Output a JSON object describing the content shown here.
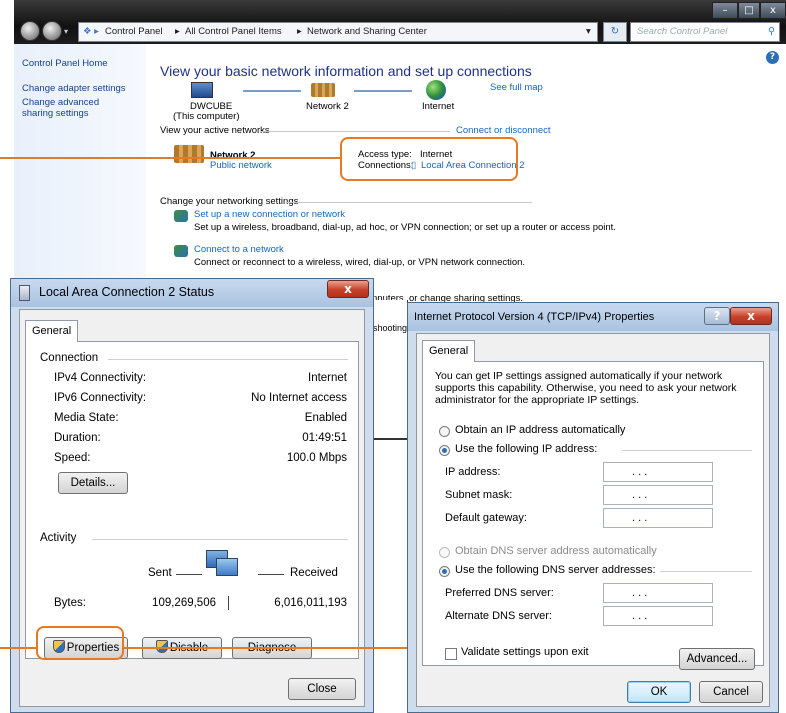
{
  "control_panel": {
    "breadcrumbs": [
      "Control Panel",
      "All Control Panel Items",
      "Network and Sharing Center"
    ],
    "search_placeholder": "Search Control Panel",
    "sidebar": [
      "Control Panel Home",
      "Change adapter settings",
      "Change advanced sharing settings"
    ],
    "title": "View your basic network information and set up connections",
    "see_full_map": "See full map",
    "map": {
      "computer": "DWCUBE",
      "computer_sub": "(This computer)",
      "network": "Network  2",
      "internet": "Internet"
    },
    "active_networks_label": "View your active networks",
    "connect_or_disconnect": "Connect or disconnect",
    "active_network_name": "Network  2",
    "active_network_type": "Public network",
    "access_type_label": "Access type:",
    "access_type_value": "Internet",
    "connections_label": "Connections:",
    "connections_value": "Local Area Connection 2",
    "change_settings_label": "Change your networking settings",
    "tasks": [
      {
        "title": "Set up a new connection or network",
        "desc": "Set up a wireless, broadband, dial-up, ad hoc, or VPN connection; or set up a router or access point."
      },
      {
        "title": "Connect to a network",
        "desc": "Connect or reconnect to a wireless, wired, dial-up, or VPN network connection."
      }
    ],
    "partial_text_1": "nputers, or change sharing settings.",
    "partial_text_2": "shooting"
  },
  "status_dialog": {
    "title": "Local Area Connection 2 Status",
    "close_x": "x",
    "tab": "General",
    "connection_label": "Connection",
    "rows": [
      {
        "label": "IPv4 Connectivity:",
        "value": "Internet"
      },
      {
        "label": "IPv6 Connectivity:",
        "value": "No Internet access"
      },
      {
        "label": "Media State:",
        "value": "Enabled"
      },
      {
        "label": "Duration:",
        "value": "01:49:51"
      },
      {
        "label": "Speed:",
        "value": "100.0 Mbps"
      }
    ],
    "details_button": "Details...",
    "activity_label": "Activity",
    "sent": "Sent",
    "received": "Received",
    "bytes_label": "Bytes:",
    "bytes_sent": "109,269,506",
    "bytes_received": "6,016,011,193",
    "properties_button": "Properties",
    "disable_button": "Disable",
    "diagnose_button": "Diagnose",
    "close_button": "Close"
  },
  "ip_dialog": {
    "title": "Internet Protocol Version 4 (TCP/IPv4) Properties",
    "help_btn": "?",
    "close_x": "x",
    "tab": "General",
    "description": "You can get IP settings assigned automatically if your network supports this capability. Otherwise, you need to ask your network administrator for the appropriate IP settings.",
    "obtain_ip_auto": "Obtain an IP address automatically",
    "use_following_ip": "Use the following IP address:",
    "ip_address": "IP address:",
    "subnet_mask": "Subnet mask:",
    "default_gateway": "Default gateway:",
    "obtain_dns_auto": "Obtain DNS server address automatically",
    "use_following_dns": "Use the following DNS server addresses:",
    "preferred_dns": "Preferred DNS server:",
    "alternate_dns": "Alternate DNS server:",
    "validate": "Validate settings upon exit",
    "advanced_button": "Advanced...",
    "ok_button": "OK",
    "cancel_button": "Cancel",
    "ip_value_dots": ".     .     ."
  },
  "colors": {
    "callout": "#e57a24",
    "link": "#1565c0",
    "title_blue": "#1e3287"
  }
}
